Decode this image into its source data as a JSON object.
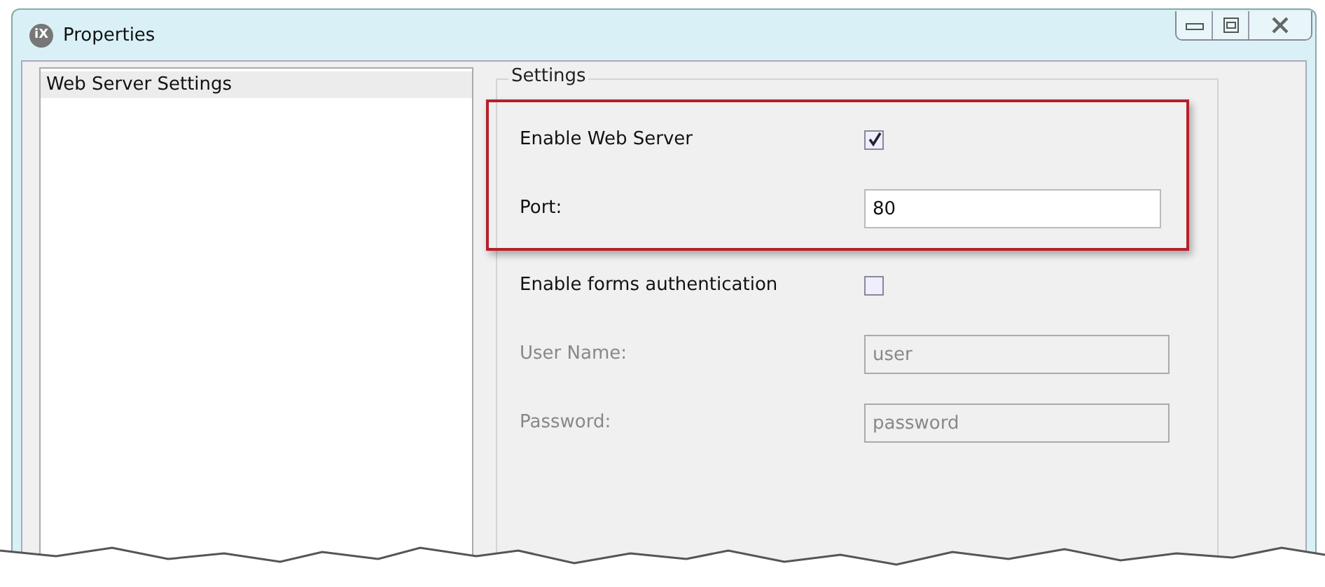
{
  "window": {
    "title": "Properties",
    "app_icon": "iX"
  },
  "sidebar": {
    "items": [
      {
        "label": "Web Server Settings",
        "selected": true
      }
    ]
  },
  "settings": {
    "title": "Settings",
    "rows": [
      {
        "kind": "checkbox",
        "label": "Enable Web Server",
        "checked": true,
        "disabled": false,
        "highlighted": true
      },
      {
        "kind": "field",
        "label": "Port:",
        "value": "80",
        "disabled": false,
        "highlighted": true
      },
      {
        "kind": "checkbox",
        "label": "Enable forms authentication",
        "checked": false,
        "disabled": false,
        "highlighted": false
      },
      {
        "kind": "field",
        "label": "User Name:",
        "value": "user",
        "disabled": true,
        "highlighted": false
      },
      {
        "kind": "field",
        "label": "Password:",
        "value": "password",
        "disabled": true,
        "highlighted": false
      }
    ]
  }
}
